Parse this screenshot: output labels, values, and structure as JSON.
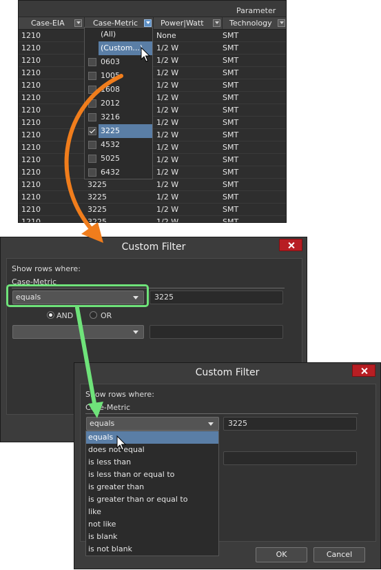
{
  "grid": {
    "group_header": "Parameter",
    "columns": [
      "Case-EIA",
      "Case-Metric",
      "Power|Watt",
      "Technology"
    ],
    "rows": [
      [
        "1210",
        "",
        "None",
        "SMT"
      ],
      [
        "1210",
        "",
        "1/2 W",
        "SMT"
      ],
      [
        "1210",
        "",
        "1/2 W",
        "SMT"
      ],
      [
        "1210",
        "",
        "1/2 W",
        "SMT"
      ],
      [
        "1210",
        "",
        "1/2 W",
        "SMT"
      ],
      [
        "1210",
        "",
        "1/2 W",
        "SMT"
      ],
      [
        "1210",
        "",
        "1/2 W",
        "SMT"
      ],
      [
        "1210",
        "",
        "1/2 W",
        "SMT"
      ],
      [
        "1210",
        "",
        "1/2 W",
        "SMT"
      ],
      [
        "1210",
        "",
        "1/2 W",
        "SMT"
      ],
      [
        "1210",
        "",
        "1/2 W",
        "SMT"
      ],
      [
        "1210",
        "",
        "1/2 W",
        "SMT"
      ],
      [
        "1210",
        "3225",
        "1/2 W",
        "SMT"
      ],
      [
        "1210",
        "3225",
        "1/2 W",
        "SMT"
      ],
      [
        "1210",
        "3225",
        "1/2 W",
        "SMT"
      ],
      [
        "1210",
        "3225",
        "1/2 W",
        "SMT"
      ],
      [
        "1210",
        "3225",
        "",
        ""
      ]
    ]
  },
  "filter_list": {
    "items": [
      {
        "label": "(All)",
        "checkbox": false,
        "checked": false,
        "selected": false
      },
      {
        "label": "(Custom...)",
        "checkbox": false,
        "checked": false,
        "selected": true
      },
      {
        "label": "0603",
        "checkbox": true,
        "checked": false,
        "selected": false
      },
      {
        "label": "1005",
        "checkbox": true,
        "checked": false,
        "selected": false
      },
      {
        "label": "1608",
        "checkbox": true,
        "checked": false,
        "selected": false
      },
      {
        "label": "2012",
        "checkbox": true,
        "checked": false,
        "selected": false
      },
      {
        "label": "3216",
        "checkbox": true,
        "checked": false,
        "selected": false
      },
      {
        "label": "3225",
        "checkbox": true,
        "checked": true,
        "selected": true
      },
      {
        "label": "4532",
        "checkbox": true,
        "checked": false,
        "selected": false
      },
      {
        "label": "5025",
        "checkbox": true,
        "checked": false,
        "selected": false
      },
      {
        "label": "6432",
        "checkbox": true,
        "checked": false,
        "selected": false
      }
    ]
  },
  "dialog1": {
    "title": "Custom Filter",
    "show_rows": "Show rows where:",
    "field": "Case-Metric",
    "operator": "equals",
    "value": "3225",
    "and_label": "AND",
    "or_label": "OR",
    "and_selected": true,
    "operator2": "",
    "value2": ""
  },
  "dialog2": {
    "title": "Custom Filter",
    "show_rows": "Show rows where:",
    "field": "Case-Metric",
    "operator": "equals",
    "value": "3225",
    "ok_label": "OK",
    "cancel_label": "Cancel",
    "operators": [
      "equals",
      "does not equal",
      "is less than",
      "is less than or equal to",
      "is greater than",
      "is greater than or equal to",
      "like",
      "not like",
      "is blank",
      "is not blank"
    ],
    "selected_operator": "equals"
  },
  "colors": {
    "accent_orange": "#f07d1c",
    "accent_green": "#6fe37a",
    "selection_blue": "#5a7ea6",
    "close_red": "#b81e23"
  },
  "icons": [
    "filter-icon",
    "checkmark-icon",
    "close-icon",
    "chevron-down-icon",
    "mouse-cursor-icon"
  ]
}
